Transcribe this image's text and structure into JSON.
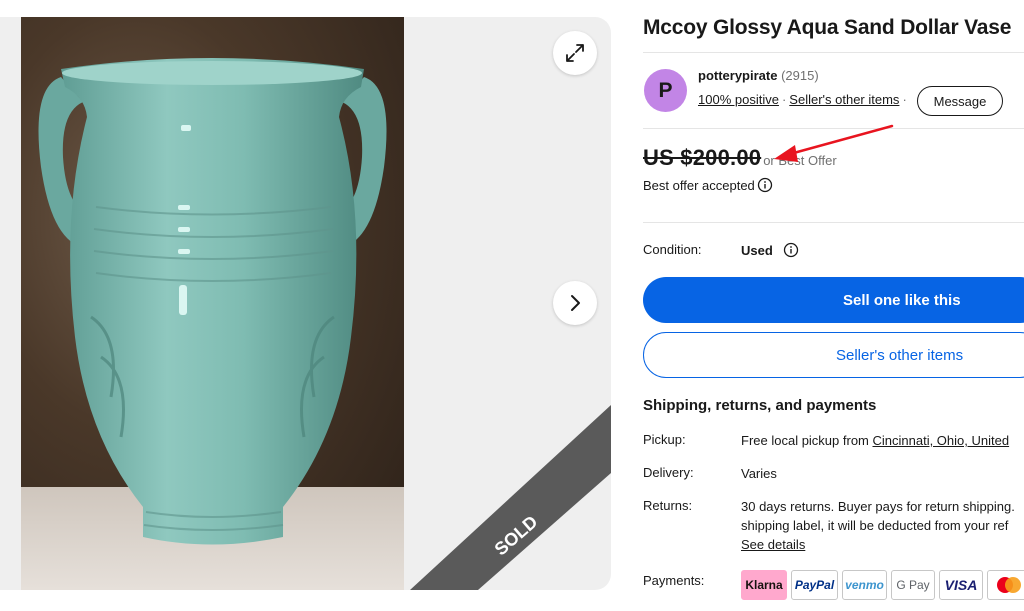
{
  "listing": {
    "title": "Mccoy Glossy Aqua Sand Dollar Vase"
  },
  "gallery": {
    "sold_banner": "SOLD"
  },
  "seller": {
    "avatar_letter": "P",
    "name": "potterypirate",
    "feedback_count": "(2915)",
    "positive": "100% positive",
    "separator": "·",
    "other_items_link": "Seller's other items",
    "message_button": "Message"
  },
  "pricing": {
    "price": "US $200.00",
    "or_best_offer": "or Best Offer",
    "best_offer_accepted": "Best offer accepted"
  },
  "condition": {
    "label": "Condition:",
    "value": "Used"
  },
  "actions": {
    "sell_one_like_this": "Sell one like this",
    "sellers_other_items": "Seller's other items"
  },
  "shipping": {
    "section_title": "Shipping, returns, and payments",
    "pickup_label": "Pickup:",
    "pickup_text": "Free local pickup from ",
    "pickup_location": "Cincinnati, Ohio, United",
    "delivery_label": "Delivery:",
    "delivery_value": "Varies",
    "returns_label": "Returns:",
    "returns_line1": "30 days returns. Buyer pays for return shipping.",
    "returns_line2": "shipping label, it will be deducted from your ref",
    "see_details": "See details",
    "payments_label": "Payments:",
    "payment_methods": [
      "Klarna",
      "PayPal",
      "venmo",
      "G Pay",
      "VISA"
    ]
  },
  "colors": {
    "accent_blue": "#0764e4",
    "avatar_purple": "#c285e6",
    "annotation_red": "#e8141f"
  }
}
